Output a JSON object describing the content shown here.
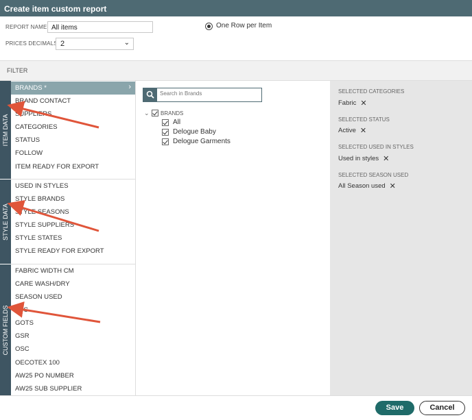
{
  "window": {
    "title": "Create item custom report"
  },
  "form": {
    "report_name_label": "REPORT NAME:",
    "report_name_value": "All items",
    "prices_decimals_label": "PRICES DECIMALS:",
    "prices_decimals_value": "2",
    "row_option_label": "One Row per Item"
  },
  "filter": {
    "title": "FILTER"
  },
  "tabs": {
    "item_data": "ITEM DATA",
    "style_data": "STYLE DATA",
    "custom_fields": "CUSTOM FIELDS"
  },
  "item_data_items": [
    "BRANDS *",
    "BRAND CONTACT",
    "SUPPLIERS",
    "CATEGORIES",
    "STATUS",
    "FOLLOW",
    "ITEM READY FOR EXPORT"
  ],
  "style_data_items": [
    "USED IN STYLES",
    "STYLE BRANDS",
    "STYLE SEASONS",
    "STYLE SUPPLIERS",
    "STYLE STATES",
    "STYLE READY FOR EXPORT"
  ],
  "custom_fields_items": [
    "FABRIC WIDTH CM",
    "CARE WASH/DRY",
    "SEASON USED",
    "FSC",
    "GOTS",
    "GSR",
    "OSC",
    "OECOTEX 100",
    "AW25 PO NUMBER",
    "AW25 SUB SUPPLIER"
  ],
  "search": {
    "placeholder": "Search in Brands"
  },
  "tree": {
    "root_label": "BRANDS",
    "children": [
      "All",
      "Delogue Baby",
      "Delogue Garments"
    ]
  },
  "selected": [
    {
      "heading": "SELECTED CATEGORIES",
      "value": "Fabric"
    },
    {
      "heading": "SELECTED STATUS",
      "value": "Active"
    },
    {
      "heading": "SELECTED USED IN STYLES",
      "value": "Used in styles"
    },
    {
      "heading": "SELECTED SEASON USED",
      "value": "All Season used"
    }
  ],
  "footer": {
    "save_label": "Save",
    "cancel_label": "Cancel"
  },
  "colors": {
    "header": "#4e6a73",
    "tab": "#3e5562",
    "active_item": "#8aa5ab",
    "save": "#1f6b69",
    "arrow": "#e0553a"
  }
}
